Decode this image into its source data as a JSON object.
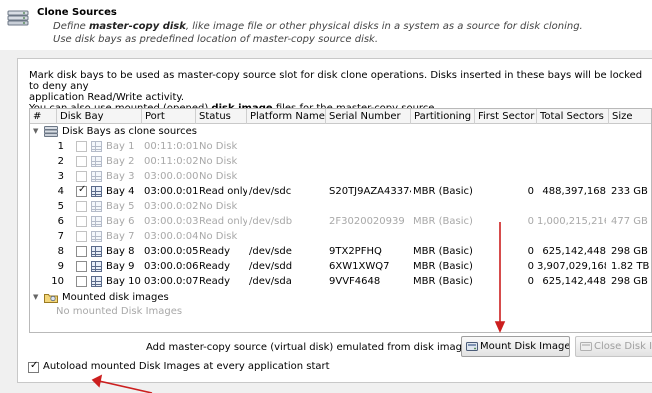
{
  "header": {
    "title": "Clone Sources",
    "desc_line1_pre": "Define ",
    "desc_line1_bold": "master-copy disk",
    "desc_line1_post": ", like image file or other physical disks in a system as a source for disk cloning.",
    "desc_line2": "Use disk bays as predefined location of master-copy source disk."
  },
  "intro": {
    "line1": "Mark disk bays to be used as master-copy source slot for disk clone operations. Disks inserted in these bays will be locked to deny any",
    "line2": "application Read/Write activity.",
    "line3_pre": "You can also use mounted (opened) ",
    "line3_bold": "disk image",
    "line3_post": " files for the master-copy source."
  },
  "table": {
    "columns": [
      "#",
      "Disk Bay",
      "Port",
      "Status",
      "Platform Name",
      "Serial Number",
      "Partitioning",
      "First Sector",
      "Total Sectors",
      "Size"
    ],
    "group_bays": "Disk Bays as clone sources",
    "rows": [
      {
        "num": "1",
        "checked": false,
        "bay": "Bay 1",
        "port": "00:11:0:01",
        "status": "No Disk",
        "platform": "",
        "serial": "",
        "partitioning": "",
        "first": "",
        "total": "",
        "size": "",
        "dim": true
      },
      {
        "num": "2",
        "checked": false,
        "bay": "Bay 2",
        "port": "00:11:0:02",
        "status": "No Disk",
        "platform": "",
        "serial": "",
        "partitioning": "",
        "first": "",
        "total": "",
        "size": "",
        "dim": true
      },
      {
        "num": "3",
        "checked": false,
        "bay": "Bay 3",
        "port": "03:00.0:00",
        "status": "No Disk",
        "platform": "",
        "serial": "",
        "partitioning": "",
        "first": "",
        "total": "",
        "size": "",
        "dim": true
      },
      {
        "num": "4",
        "checked": true,
        "bay": "Bay 4",
        "port": "03:00.0:01",
        "status": "Read only",
        "platform": "/dev/sdc",
        "serial": "S20TJ9AZA43374",
        "partitioning": "MBR (Basic)",
        "first": "0",
        "total": "488,397,168",
        "size": "233 GB",
        "dim": false
      },
      {
        "num": "5",
        "checked": false,
        "bay": "Bay 5",
        "port": "03:00.0:02",
        "status": "No Disk",
        "platform": "",
        "serial": "",
        "partitioning": "",
        "first": "",
        "total": "",
        "size": "",
        "dim": true
      },
      {
        "num": "6",
        "checked": false,
        "bay": "Bay 6",
        "port": "03:00.0:03",
        "status": "Read only",
        "platform": "/dev/sdb",
        "serial": "2F3020020939",
        "partitioning": "MBR (Basic)",
        "first": "0",
        "total": "1,000,215,216",
        "size": "477 GB",
        "dim": true
      },
      {
        "num": "7",
        "checked": false,
        "bay": "Bay 7",
        "port": "03:00.0:04",
        "status": "No Disk",
        "platform": "",
        "serial": "",
        "partitioning": "",
        "first": "",
        "total": "",
        "size": "",
        "dim": true
      },
      {
        "num": "8",
        "checked": false,
        "bay": "Bay 8",
        "port": "03:00.0:05",
        "status": "Ready",
        "platform": "/dev/sde",
        "serial": "9TX2PFHQ",
        "partitioning": "MBR (Basic)",
        "first": "0",
        "total": "625,142,448",
        "size": "298 GB",
        "dim": false
      },
      {
        "num": "9",
        "checked": false,
        "bay": "Bay 9",
        "port": "03:00.0:06",
        "status": "Ready",
        "platform": "/dev/sdd",
        "serial": "6XW1XWQ7",
        "partitioning": "MBR (Basic)",
        "first": "0",
        "total": "3,907,029,168",
        "size": "1.82 TB",
        "dim": false
      },
      {
        "num": "10",
        "checked": false,
        "bay": "Bay 10",
        "port": "03:00.0:07",
        "status": "Ready",
        "platform": "/dev/sda",
        "serial": "9VVF4648",
        "partitioning": "MBR (Basic)",
        "first": "0",
        "total": "625,142,448",
        "size": "298 GB",
        "dim": false
      }
    ],
    "group_images": "Mounted disk images",
    "no_images": "No mounted Disk Images"
  },
  "bottom": {
    "add_label": "Add master-copy source (virtual disk) emulated from disk image file:",
    "mount_button": "Mount Disk Image",
    "close_button": "Close Disk Image",
    "autoload_label": "Autoload mounted Disk Images at every application start",
    "autoload_checked": true
  },
  "colors": {
    "annotation_arrow": "#cc1f1f",
    "dim_text": "#a8a8a8"
  },
  "icons": [
    "disk-stack-icon",
    "disk-bay-grid-icon",
    "folder-disk-icon",
    "mount-image-icon",
    "close-image-icon"
  ]
}
